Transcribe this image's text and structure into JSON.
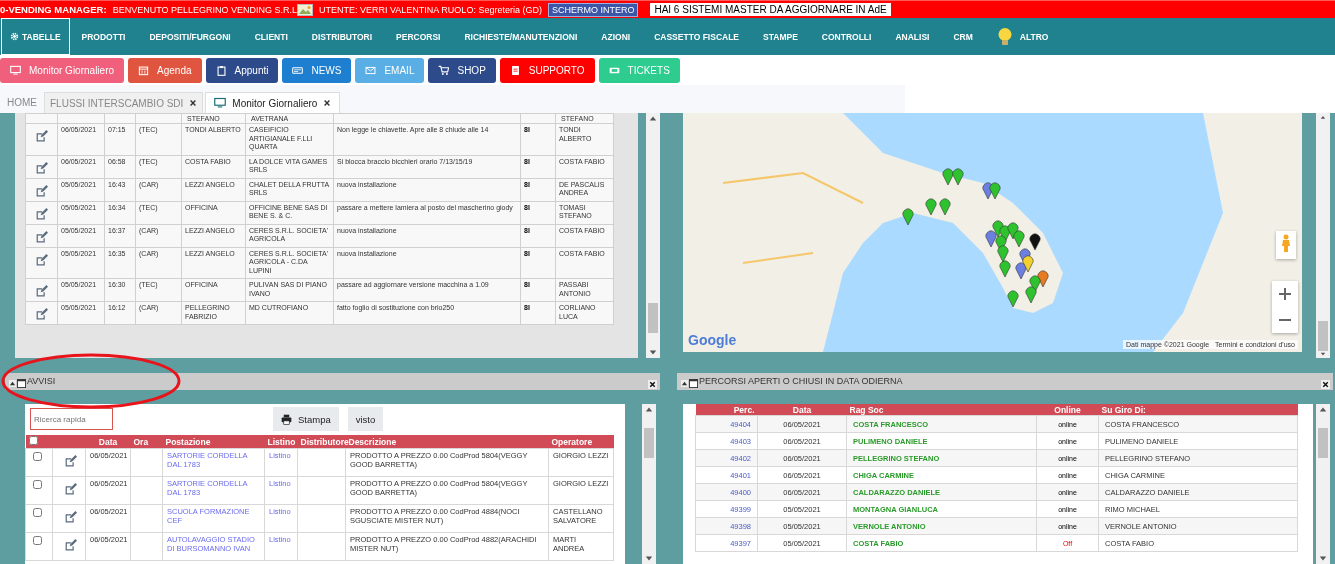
{
  "header": {
    "app_title": "0-VENDING MANAGER:",
    "welcome": "BENVENUTO PELLEGRINO VENDING S.R.L",
    "user": "UTENTE: VERRI VALENTINA RUOLO: Segreteria (GD)",
    "fullscreen_button": "SCHERMO INTERO",
    "alert": "HAI 6 SISTEMI MASTER DA AGGIORNARE IN AdE"
  },
  "nav": [
    {
      "label": "TABELLE",
      "selected": true
    },
    {
      "label": "PRODOTTI",
      "selected": false
    },
    {
      "label": "DEPOSITI/FURGONI",
      "selected": false
    },
    {
      "label": "CLIENTI",
      "selected": false
    },
    {
      "label": "DISTRIBUTORI",
      "selected": false
    },
    {
      "label": "PERCORSI",
      "selected": false
    },
    {
      "label": "RICHIESTE/MANUTENZIONI",
      "selected": false
    },
    {
      "label": "AZIONI",
      "selected": false
    },
    {
      "label": "CASSETTO FISCALE",
      "selected": false
    },
    {
      "label": "STAMPE",
      "selected": false
    },
    {
      "label": "CONTROLLI",
      "selected": false
    },
    {
      "label": "ANALISI",
      "selected": false
    },
    {
      "label": "CRM",
      "selected": false
    },
    {
      "label": "ALTRO",
      "selected": false
    }
  ],
  "quick_buttons": [
    {
      "label": "Monitor Giornaliero",
      "color": "#f0607d"
    },
    {
      "label": "Agenda",
      "color": "#e0553f"
    },
    {
      "label": "Appunti",
      "color": "#2d4a8a"
    },
    {
      "label": "NEWS",
      "color": "#1e7fd0"
    },
    {
      "label": "EMAIL",
      "color": "#5aaee6"
    },
    {
      "label": "SHOP",
      "color": "#2d4a8a"
    },
    {
      "label": "SUPPORTO",
      "color": "#ff0000"
    },
    {
      "label": "TICKETS",
      "color": "#2ecc8e"
    }
  ],
  "tabs": [
    {
      "label": "HOME",
      "selected": false,
      "closable": false
    },
    {
      "label": "FLUSSI INTERSCAMBIO SDI",
      "selected": false,
      "closable": true
    },
    {
      "label": "Monitor Giornaliero",
      "selected": true,
      "closable": true
    }
  ],
  "interventions": {
    "rows": [
      {
        "operator": "STEFANO",
        "location": "AVETRANA",
        "assignee": "STEFANO"
      },
      {
        "date": "06/05/2021",
        "time": "07:15",
        "type": "(TEC)",
        "operator": "TONDI ALBERTO",
        "location": "CASEIFICIO ARTIGIANALE F.LLI QUARTA",
        "note": "Non legge le chiavette. Apre alle 8 chiude alle 14",
        "code": "8l",
        "assignee": "TONDI ALBERTO"
      },
      {
        "date": "06/05/2021",
        "time": "06:58",
        "type": "(TEC)",
        "operator": "COSTA FABIO",
        "location": "LA DOLCE VITA GAMES SRLS",
        "note": "Si blocca braccio bicchieri orario 7/13/15/19",
        "code": "8l",
        "assignee": "COSTA FABIO"
      },
      {
        "date": "05/05/2021",
        "time": "16:43",
        "type": "(CAR)",
        "operator": "LEZZI ANGELO",
        "location": "CHALET DELLA FRUTTA SRLS",
        "note": "nuova installazione",
        "code": "8l",
        "assignee": "DE PASCALIS ANDREA"
      },
      {
        "date": "05/05/2021",
        "time": "16:34",
        "type": "(TEC)",
        "operator": "OFFICINA",
        "location": "OFFICINE BENE SAS DI BENE S. & C.",
        "note": "passare a mettere lamiera al posto del mascherino giody",
        "code": "8l",
        "assignee": "TOMASI STEFANO"
      },
      {
        "date": "05/05/2021",
        "time": "16:37",
        "type": "(CAR)",
        "operator": "LEZZI ANGELO",
        "location": "CERES S.R.L. SOCIETA' AGRICOLA",
        "note": "nuova installazione",
        "code": "8l",
        "assignee": "COSTA FABIO"
      },
      {
        "date": "05/05/2021",
        "time": "16:35",
        "type": "(CAR)",
        "operator": "LEZZI ANGELO",
        "location": "CERES S.R.L. SOCIETA' AGRICOLA - C.DA LUPINI",
        "note": "nuova installazione",
        "code": "8l",
        "assignee": "COSTA FABIO"
      },
      {
        "date": "05/05/2021",
        "time": "16:30",
        "type": "(TEC)",
        "operator": "OFFICINA",
        "location": "PULIVAN SAS DI PIANO IVANO",
        "note": "passare ad aggiornare versione macchina a 1.09",
        "code": "8l",
        "assignee": "PASSABI ANTONIO"
      },
      {
        "date": "05/05/2021",
        "time": "16:12",
        "type": "(CAR)",
        "operator": "PELLEGRINO FABRIZIO",
        "location": "MD CUTROFIANO",
        "note": "fatto foglio di sostituzione con brio250",
        "code": "8l",
        "assignee": "CORLIANO LUCA"
      }
    ]
  },
  "map": {
    "logo": "Google",
    "attribution": "Dati mappe ©2021 Google",
    "terms": "Termini e condizioni d'uso"
  },
  "avvisi": {
    "title": "AVVISI",
    "search_placeholder": "Ricerca rapida",
    "print_button": "Stampa",
    "seen_button": "visto",
    "select_all_checked": false,
    "columns": [
      "Data",
      "Ora",
      "Postazione",
      "Listino",
      "Distributore",
      "Descrizione",
      "Operatore"
    ],
    "rows": [
      {
        "checked": false,
        "date": "06/05/2021",
        "location": "SARTORIE CORDELLA DAL 1783",
        "price_list": "Listino",
        "description": "PRODOTTO A PREZZO 0.00 CodProd 5804(VEGGY GOOD BARRETTA)",
        "operator": "GIORGIO LEZZI"
      },
      {
        "checked": false,
        "date": "06/05/2021",
        "location": "SARTORIE CORDELLA DAL 1783",
        "price_list": "Listino",
        "description": "PRODOTTO A PREZZO 0.00 CodProd 5804(VEGGY GOOD BARRETTA)",
        "operator": "GIORGIO LEZZI"
      },
      {
        "checked": false,
        "date": "06/05/2021",
        "location": "SCUOLA FORMAZIONE CEF",
        "price_list": "Listino",
        "description": "PRODOTTO A PREZZO 0.00 CodProd 4884(NOCI SGUSCIATE MISTER NUT)",
        "operator": "CASTELLANO SALVATORE"
      },
      {
        "checked": false,
        "date": "06/05/2021",
        "location": "AUTOLAVAGGIO STADIO DI BURSOMANNO IVAN",
        "price_list": "Listino",
        "description": "PRODOTTO A PREZZO 0.00 CodProd 4882(ARACHIDI MISTER NUT)",
        "operator": "MARTI ANDREA"
      }
    ]
  },
  "percorsi": {
    "title": "PERCORSI APERTI O CHIUSI IN DATA ODIERNA",
    "columns": [
      "Perc.",
      "Data",
      "Rag Soc",
      "Online",
      "Su Giro Di:"
    ],
    "rows": [
      {
        "number": "49404",
        "date": "06/05/2021",
        "company": "COSTA FRANCESCO",
        "status": "online",
        "online": true,
        "round": "COSTA FRANCESCO"
      },
      {
        "number": "49403",
        "date": "06/05/2021",
        "company": "PULIMENO DANIELE",
        "status": "online",
        "online": true,
        "round": "PULIMENO DANIELE"
      },
      {
        "number": "49402",
        "date": "06/05/2021",
        "company": "PELLEGRINO STEFANO",
        "status": "online",
        "online": true,
        "round": "PELLEGRINO STEFANO"
      },
      {
        "number": "49401",
        "date": "06/05/2021",
        "company": "CHIGA CARMINE",
        "status": "online",
        "online": true,
        "round": "CHIGA CARMINE"
      },
      {
        "number": "49400",
        "date": "06/05/2021",
        "company": "CALDARAZZO DANIELE",
        "status": "online",
        "online": true,
        "round": "CALDARAZZO DANIELE"
      },
      {
        "number": "49399",
        "date": "05/05/2021",
        "company": "MONTAGNA GIANLUCA",
        "status": "online",
        "online": true,
        "round": "RIMO MICHAEL"
      },
      {
        "number": "49398",
        "date": "05/05/2021",
        "company": "VERNOLE ANTONIO",
        "status": "online",
        "online": true,
        "round": "VERNOLE ANTONIO"
      },
      {
        "number": "49397",
        "date": "05/05/2021",
        "company": "COSTA FABIO",
        "status": "Off",
        "online": false,
        "round": "COSTA FABIO"
      }
    ]
  }
}
